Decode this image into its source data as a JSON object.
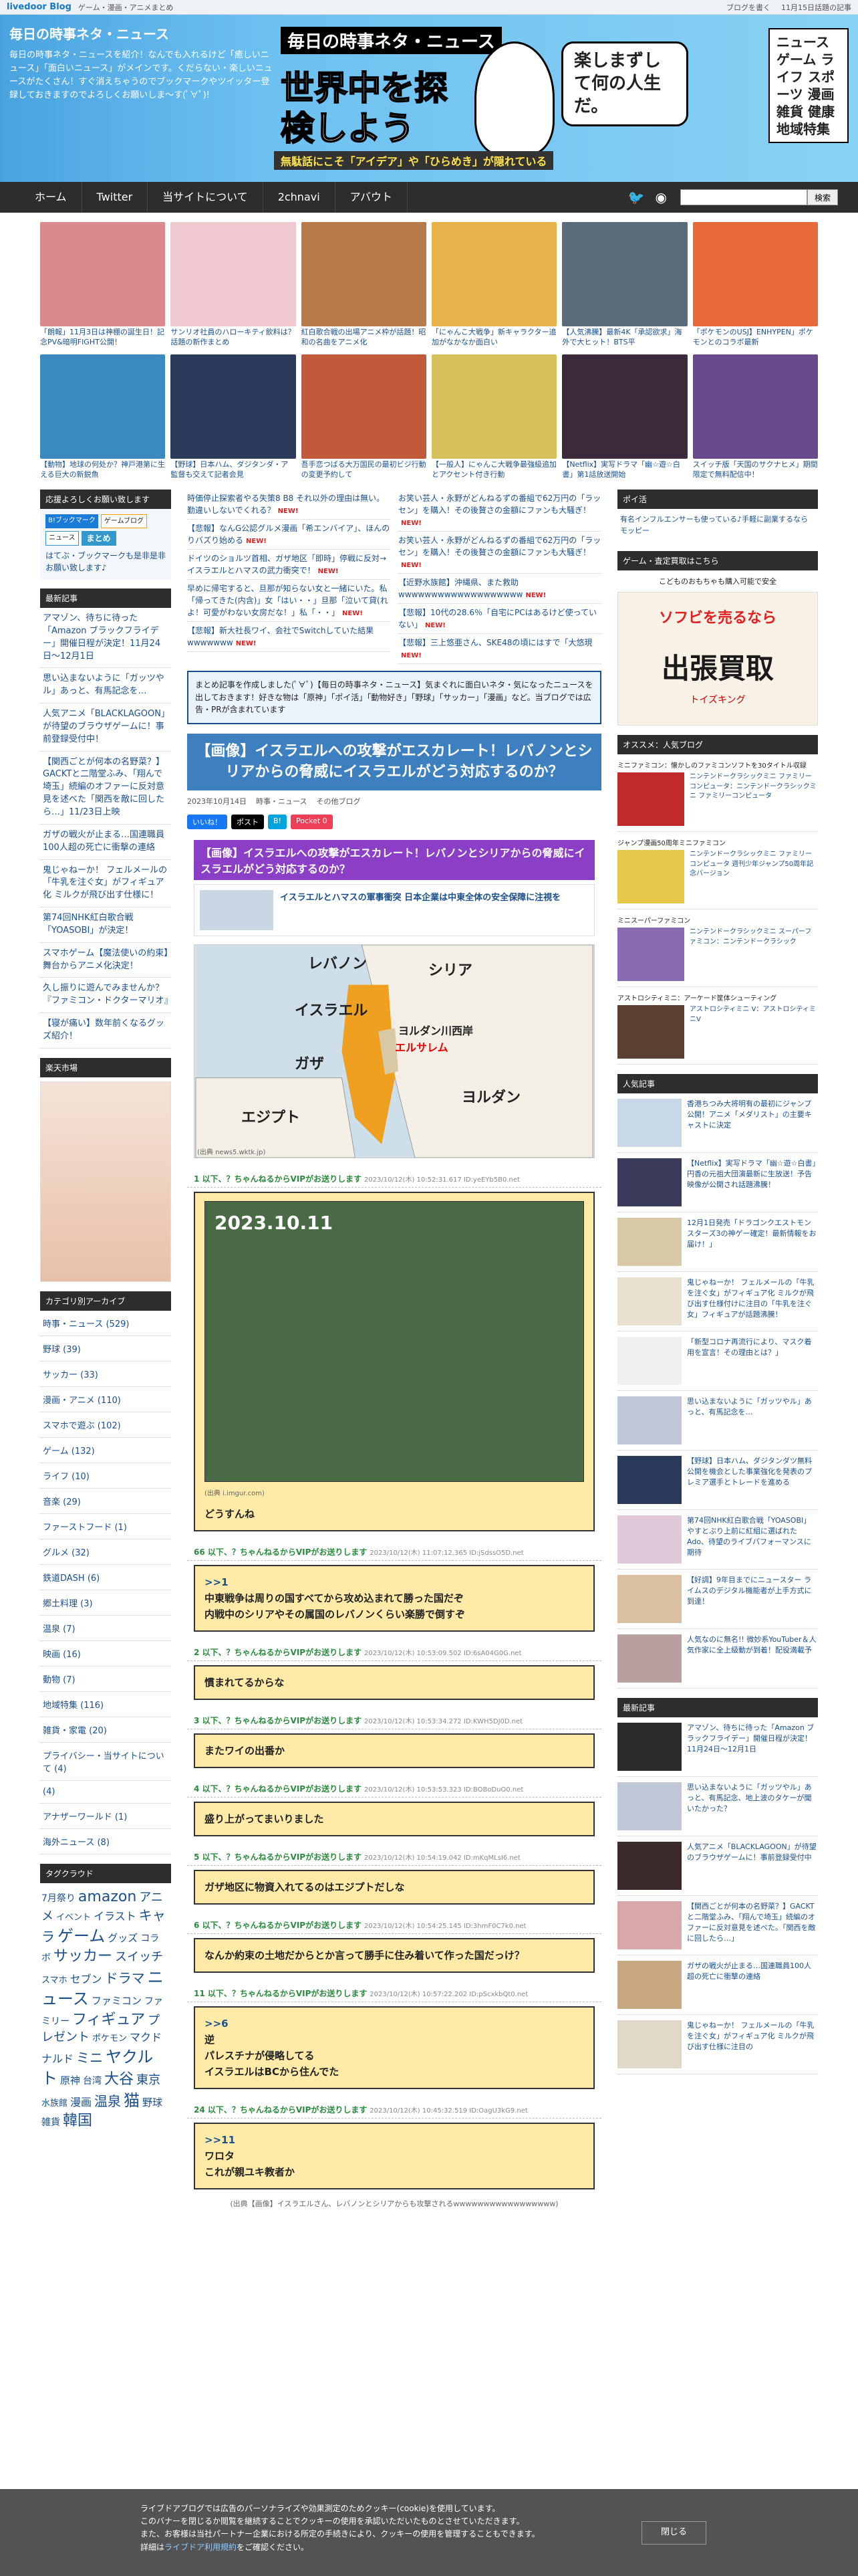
{
  "topbar": {
    "logo": "livedoor Blog",
    "service": "ゲーム・漫画・アニメまとめ",
    "links": [
      "ブログを書く",
      "11月15日話題の記事"
    ]
  },
  "header": {
    "site_title": "毎日の時事ネタ・ニュース",
    "description": "毎日の時事ネタ・ニュースを紹介！なんでも入れるけど「癒しいニュース」「面白いニュース」がメインです。くだらない・楽しいニュースがたくさん！すぐ消えちゃうのでブックマークやツイッター登録しておきますのでよろしくお願いしま〜す(ﾟ∀ﾟ)!",
    "banner_title": "毎日の時事ネタ・ニュース",
    "banner_main": "世界中を探検しよう",
    "banner_sub": "無駄話にこそ「アイデア」や「ひらめき」が隠れている",
    "bubble": "楽しまずして何の人生だ。",
    "categories": "ニュース ゲーム ライフ スポーツ 漫画 雑貨 健康 地域特集"
  },
  "nav": {
    "items": [
      "ホーム",
      "Twitter",
      "当サイトについて",
      "2chnavi",
      "アバウト"
    ],
    "search_placeholder": "",
    "search_button": "検索"
  },
  "thumbs": [
    {
      "cap": "「朗報」11月3日は神棚の誕生日！記念PV&暗明FIGHT公開！",
      "color": "#d98a8a"
    },
    {
      "cap": "サンリオ社員のハローキティ飲料は？ 話題の新作まとめ",
      "color": "#f0c8cf"
    },
    {
      "cap": "紅白歌合戦の出場アニメ枠が話題！昭和の名曲をアニメ化",
      "color": "#b87a4a"
    },
    {
      "cap": "「にゃんこ大戦争」新キャラクター追加がなかなか面白い",
      "color": "#e8b24a"
    },
    {
      "cap": "【人気沸騰】最新4K「承認欲求」海外で大ヒット！BTS平",
      "color": "#5a6b7a"
    },
    {
      "cap": "「ポケモンのUSJ】ENHYPEN」ポケモンとのコラボ最新",
      "color": "#e86a3a"
    },
    {
      "cap": "【動物】地球の何处か？神戸港第に生える巨大の新鋭魚",
      "color": "#3a8ac0"
    },
    {
      "cap": "【野球】日本ハム、ダジタンダ・ア 監督も交えて記者会見",
      "color": "#2a3a5a"
    },
    {
      "cap": "吾手恋つばる大万国民の最初ビジ行動の変更予約して",
      "color": "#c05a3a"
    },
    {
      "cap": "【一般人】にゃんこ大戦争最強級追加とアクセント付き行動",
      "color": "#d8c05a"
    },
    {
      "cap": "【Netflix】実写ドラマ「幽☆遊☆白書」第1話放送開始",
      "color": "#3a2a3a"
    },
    {
      "cap": "スイッチ版「天国のサクナヒメ」期間限定で無料配信中！",
      "color": "#6a4a8a"
    }
  ],
  "left": {
    "support_h": "応援よろしくお願い致します",
    "support_badges": [
      "B!ブックマーク",
      "ゲームブログ",
      "ニュース",
      "まとめ"
    ],
    "support_note": "はてぶ・ブックマークも是非是非お願い致します♪",
    "recent_h": "最新記事",
    "recent": [
      "アマゾン、待ちに待った「Amazon ブラックフライデー」開催日程が決定！11月24日〜12月1日",
      "思い込まないように「ガッツやル」あっと、有馬記念を…",
      "人気アニメ「BLACKLAGOON」が待望のブラウザゲームに！事前登録受付中！",
      "【関西ごとが何本の名野菜？】GACKTと二階堂ふみ、「翔んで埼玉」続編のオファーに反対意見を述べた「関西を敵に回したら…」11/23日上映",
      "ガザの戦火が止まる…国連職員100人超の死亡に衝撃の連絡",
      "鬼じゃねーか！ フェルメールの「牛乳を注ぐ女」がフィギュア化 ミルクが飛び出す仕様に！",
      "第74回NHK紅白歌合戦「YOASOBI」が決定！",
      "スマホゲーム【魔法使いの約束】舞台からアニメ化決定！",
      "久し振りに遊んでみませんか？『ファミコン・ドクターマリオ』",
      "【寝が痛い】数年前くなるグッズ紹介！"
    ],
    "rakuten_h": "楽天市場",
    "cats_h": "カテゴリ別アーカイブ",
    "cats": [
      "時事・ニュース (529)",
      "野球 (39)",
      "サッカー (33)",
      "漫画・アニメ (110)",
      "スマホで遊ぶ (102)",
      "ゲーム (132)",
      "ライフ (10)",
      "音楽 (29)",
      "ファーストフード (1)",
      "グルメ (32)",
      "鉄道DASH (6)",
      "郷土料理 (3)",
      "温泉 (7)",
      "映画 (16)",
      "動物 (7)",
      "地域特集 (116)",
      "雑貨・家電 (20)",
      "プライバシー・当サイトについて (4)",
      "(4)",
      "アナザーワールド (1)",
      "海外ニュース (8)"
    ],
    "tags_h": "タグクラウド",
    "tags": [
      "7月祭り",
      "amazon",
      "アニメ",
      "イベント",
      "イラスト",
      "キャラ",
      "ゲーム",
      "グッズ",
      "コラボ",
      "サッカー",
      "スイッチ",
      "スマホ",
      "セブン",
      "ドラマ",
      "ニュース",
      "ファミコン",
      "ファミリー",
      "フィギュア",
      "プレゼント",
      "ポケモン",
      "マクドナルド",
      "ミニ",
      "ヤクルト",
      "原神",
      "台湾",
      "大谷",
      "東京",
      "水族館",
      "漫画",
      "温泉",
      "猫",
      "野球",
      "雑貨",
      "韓国"
    ]
  },
  "main": {
    "feed_left": [
      "時価停止探索者やる失策8 B8 それ以外の理由は無い。勤違いしないでくれる？",
      "【悲報】なんG公認グルメ漫画「希エンバイア」、ほんのりバズり始める",
      "ドイツのショルツ首相、ガザ地区「即時」停戦に反対→イスラエルとハマスの武力衝突で！",
      "早めに帰宅すると、旦那が知らない女と一緒にいた。私「帰ってきた(内含)」女「はい・・」旦那「泣いて貸(れよ！可愛がわない女房だな！」私「・・」",
      "【悲報】新大社長ワイ、会社でSwitchしていた結果wwwwwww"
    ],
    "feed_right": [
      "お笑い芸人・永野がどんねるずの番組で62万円の「ラッセン」を購入！その後贅さの金額にファンも大騒ぎ！",
      "お笑い芸人・永野がどんねるずの番組で62万円の「ラッセン」を購入！その後贅さの金額にファンも大騒ぎ！",
      "【近野水族館】沖縄県、また救助wwwwwwwwwwwwwwwwwww",
      "【悲報】10代の28.6％「自宅にPCはあるけど使っていない」",
      "【悲報】三上悠亜さん、SKE48の頃にはすで「大悠現"
    ],
    "blurb": "まとめ記事を作成しました(ﾟ∀ﾟ)【毎日の時事ネタ・ニュース】気まぐれに面白いネタ・気になったニュースを出しておきます！好きな物は「原神」「ポイ活」「動物好き」「野球」「サッカー」「漫画」など。当ブログでは広告・PRが含まれています",
    "title": "【画像】イスラエルへの攻撃がエスカレート！レバノンとシリアからの脅威にイスラエルがどう対応するのか？",
    "date": "2023年10月14日",
    "category": "時事・ニュース",
    "blog": "その他ブログ",
    "share": [
      "いいね！",
      "ポスト",
      "B!",
      "Pocket 0"
    ],
    "headline": "【画像】イスラエルへの攻撃がエスカレート！レバノンとシリアからの脅威にイスラエルがどう対応するのか？",
    "linkcard_title": "イスラエルとハマスの軍事衝突 日本企業は中東全体の安全保障に注視を",
    "map_labels": [
      "シリア",
      "レバノン",
      "イスラエル",
      "ヨルダン川西岸",
      "エルサレム",
      "ガザ",
      "エジプト",
      "ヨルダン"
    ],
    "map_caption": "(出典 news5.wktk.jp)",
    "posts": [
      {
        "head": "1 以下、？ちゃんねるからVIPがお送りします",
        "date": "2023/10/12(木) 10:52:31.617 ID:yeEYb5B0.net",
        "lines": [
          "どうすんね"
        ],
        "image": true,
        "image_date": "2023.10.11",
        "image_caption": "(出典 i.imgur.com)"
      },
      {
        "head": "66 以下、？ちゃんねるからVIPがお送りします",
        "date": "2023/10/12(木) 11:07:12.365 ID:jSdssO5D.net",
        "lines": [
          ">>1",
          "中東戦争は周りの国すべてから攻め込まれて勝った国だぞ",
          "内戦中のシリアやその属国のレバノンくらい楽勝で倒すぞ"
        ]
      },
      {
        "head": "2 以下、？ちゃんねるからVIPがお送りします",
        "date": "2023/10/12(木) 10:53:09.502 ID:6sA04G0G.net",
        "lines": [
          "慣まれてるからな"
        ]
      },
      {
        "head": "3 以下、？ちゃんねるからVIPがお送りします",
        "date": "2023/10/12(木) 10:53:34.272 ID:KWH5DJ0D.net",
        "lines": [
          "またワイの出番か"
        ]
      },
      {
        "head": "4 以下、？ちゃんねるからVIPがお送りします",
        "date": "2023/10/12(木) 10:53:53.323 ID:BOBoDuO0.net",
        "lines": [
          "盛り上がってまいりました"
        ]
      },
      {
        "head": "5 以下、？ちゃんねるからVIPがお送りします",
        "date": "2023/10/12(木) 10:54:19.042 ID:mKqMLsI6.net",
        "lines": [
          "ガザ地区に物資入れてるのはエジプトだしな"
        ]
      },
      {
        "head": "6 以下、？ちゃんねるからVIPがお送りします",
        "date": "2023/10/12(木) 10:54:25.145 ID:3hmF0C7k0.net",
        "lines": [
          "なんか約束の土地だからとか言って勝手に住み着いて作った国だっけ？"
        ]
      },
      {
        "head": "11 以下、？ちゃんねるからVIPがお送りします",
        "date": "2023/10/12(木) 10:57:22.202 ID:pScxkbQt0.net",
        "lines": [
          ">>6",
          "逆",
          "パレスチナが侵略してる",
          "イスラエルはBCから住んでた"
        ]
      },
      {
        "head": "24 以下、？ちゃんねるからVIPがお送りします",
        "date": "2023/10/12(木) 10:45:32.519 ID:OagU3kG9.net",
        "lines": [
          ">>11",
          "ワロタ",
          "これが親ユキ教者か"
        ]
      }
    ],
    "source_text": "(出典【画像】イスラエルさん、レバノンとシリアからも攻撃されるwwwwwwwwwwwwwwwww)"
  },
  "right": {
    "poikatsu_h": "ポイ活",
    "poikatsu_text": "有名インフルエンサーも使っている♪手軽に副業するならモッピー",
    "game_h": "ゲーム・査定買取はこちら",
    "ad_top": "こどものおもちゃも購入可能で安全",
    "ad_line1": "ソフビを売るなら",
    "ad_line2": "出張買取",
    "ad_line3": "トイズキング",
    "amazon_h": "オススメ：人気ブログ",
    "amazon": [
      {
        "label": "ミニファミコン：懐かしのファミコンソフトを30タイトル収録",
        "text": "ニンテンドークラシックミニ ファミリーコンピュータ：ニンテンドークラシックミニ ファミリーコンピュータ",
        "color": "#c02a2a"
      },
      {
        "label": "ジャンプ漫画50周年ミニファミコン",
        "text": "ニンテンドークラシックミニ ファミリーコンピュータ 週刊少年ジャンプ50周年記念バージョン",
        "color": "#e8c84a"
      },
      {
        "label": "ミニスーパーファミコン",
        "text": "ニンテンドークラシックミニ スーパーファミコン：ニンテンドークラシック",
        "color": "#8a6ab0"
      },
      {
        "label": "アストロシティミニ：アーケード筐体シューティング",
        "text": "アストロシティミニ V：アストロシティミニV",
        "color": "#5a4030"
      }
    ],
    "popular_h": "人気記事",
    "popular": [
      {
        "text": "香港ちつみ大将明有の最初にジャンプ公開！アニメ「メダリスト」の主要キャストに決定",
        "color": "#c8d8e8"
      },
      {
        "text": "【Netflix】実写ドラマ「幽☆遊☆白書」円香の元祖大団演最新に生放送！予告映像が公開され話題沸騰！",
        "color": "#3a3a5a"
      },
      {
        "text": "12月1日発売「ドラゴンクエストモンスターズ3の神ゲー確定！最新情報をお届け！」",
        "color": "#d8c8a8"
      },
      {
        "text": "鬼じゃねーか！ フェルメールの「牛乳を注ぐ女」がフィギュア化 ミルクが飛び出す仕様付けに注目の「牛乳を注ぐ女」フィギュアが話題沸騰！",
        "color": "#e8e0d0"
      },
      {
        "text": "「新型コロナ再流行により、マスク着用を宣言！その理由とは？」",
        "color": "#f0f0f0"
      },
      {
        "text": "思い込まないように「ガッツやル」あっと、有馬記念を…",
        "color": "#c0c8d8"
      },
      {
        "text": "【野球】日本ハム、ダジタンダツ無料公開を機会とした事業強化を発表のプレミア選手とトレードを進める",
        "color": "#2a3a5a"
      },
      {
        "text": "第74回NHK紅白歌合戦「YOASOBI」やすとぶり上前に紅組に選ばれたAdo、待望のライブパフォーマンスに期待",
        "color": "#e0c8d8"
      },
      {
        "text": "【好調】9年目までにニュースター ライムスのデジタル機能者が上手方式に到達！",
        "color": "#d8c0a0"
      },
      {
        "text": "人気なのに無名!! 微妙系YouTuber＆人気作家に全上級動が到着！配役満載予",
        "color": "#b8a0a0"
      }
    ],
    "latest_h": "最新記事",
    "latest": [
      {
        "text": "アマゾン、待ちに待った「Amazon ブラックフライデー」開催日程が決定！11月24日〜12月1日",
        "color": "#2a2a2a"
      },
      {
        "text": "思い込まないように「ガッツやル」あっと、有馬記念、地上波のタケーが聞いたかった？",
        "color": "#c0c8d8"
      },
      {
        "text": "人気アニメ「BLACKLAGOON」が待望のブラウザゲームに！事前登録受付中",
        "color": "#3a2a2a"
      },
      {
        "text": "【関西ごとが何本の名野菜？】GACKTと二階堂ふみ、「翔んで埼玉」続編のオファーに反対意見を述べた。「関西を敵に回したら…」",
        "color": "#d8a8a8"
      },
      {
        "text": "ガザの戦火が止まる…国連職員100人超の死亡に衝撃の連絡",
        "color": "#c8a880"
      },
      {
        "text": "鬼じゃねーか！ フェルメールの「牛乳を注ぐ女」がフィギュア化 ミルクが飛び出す仕様に注目の",
        "color": "#e0d8c8"
      }
    ]
  },
  "cookie": {
    "text1": "ライブドアブログでは広告のパーソナライズや効果測定のためクッキー(cookie)を使用しています。",
    "text2": "このバナーを閉じるか閲覧を継続することでクッキーの使用を承認いただいたものとさせていただきます。",
    "text3": "また、お客様は当社パートナー企業における所定の手続きにより、クッキーの使用を管理することもできます。",
    "text4_prefix": "詳細は",
    "text4_link": "ライブドア利用規約",
    "text4_suffix": "をご確認ください。",
    "close": "閉じる"
  }
}
